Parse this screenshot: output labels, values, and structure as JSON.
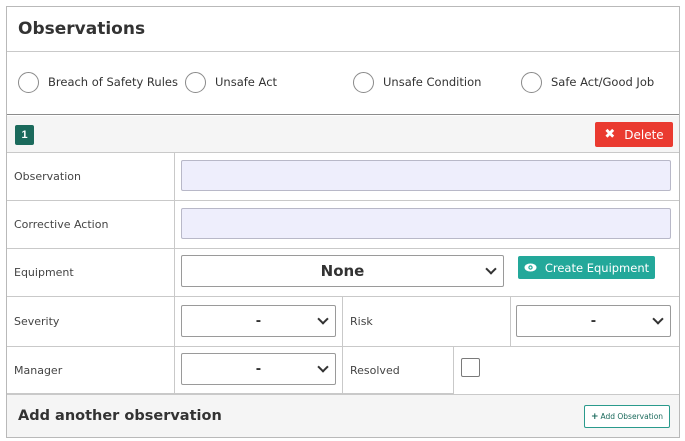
{
  "panel": {
    "title": "Observations"
  },
  "observation_types": [
    {
      "label": "Breach of Safety Rules"
    },
    {
      "label": "Unsafe Act"
    },
    {
      "label": "Unsafe Condition"
    },
    {
      "label": "Safe Act/Good Job"
    }
  ],
  "observation": {
    "number": "1",
    "delete_label": "Delete",
    "delete_icon": "close-icon",
    "fields": {
      "observation_label": "Observation",
      "observation_value": "",
      "corrective_action_label": "Corrective Action",
      "corrective_action_value": "",
      "equipment_label": "Equipment",
      "equipment_value": "None",
      "create_equipment_label": "Create Equipment",
      "create_equipment_icon": "eye-icon",
      "severity_label": "Severity",
      "severity_value": "-",
      "risk_label": "Risk",
      "risk_value": "-",
      "manager_label": "Manager",
      "manager_value": "-",
      "resolved_label": "Resolved",
      "resolved_checked": false
    }
  },
  "footer": {
    "title": "Add another observation",
    "add_label": "Add Observation",
    "add_icon": "plus-icon"
  },
  "colors": {
    "badge": "#1b6a5c",
    "delete": "#ea3a30",
    "create": "#23a89a",
    "input_bg": "#eeeefc"
  }
}
